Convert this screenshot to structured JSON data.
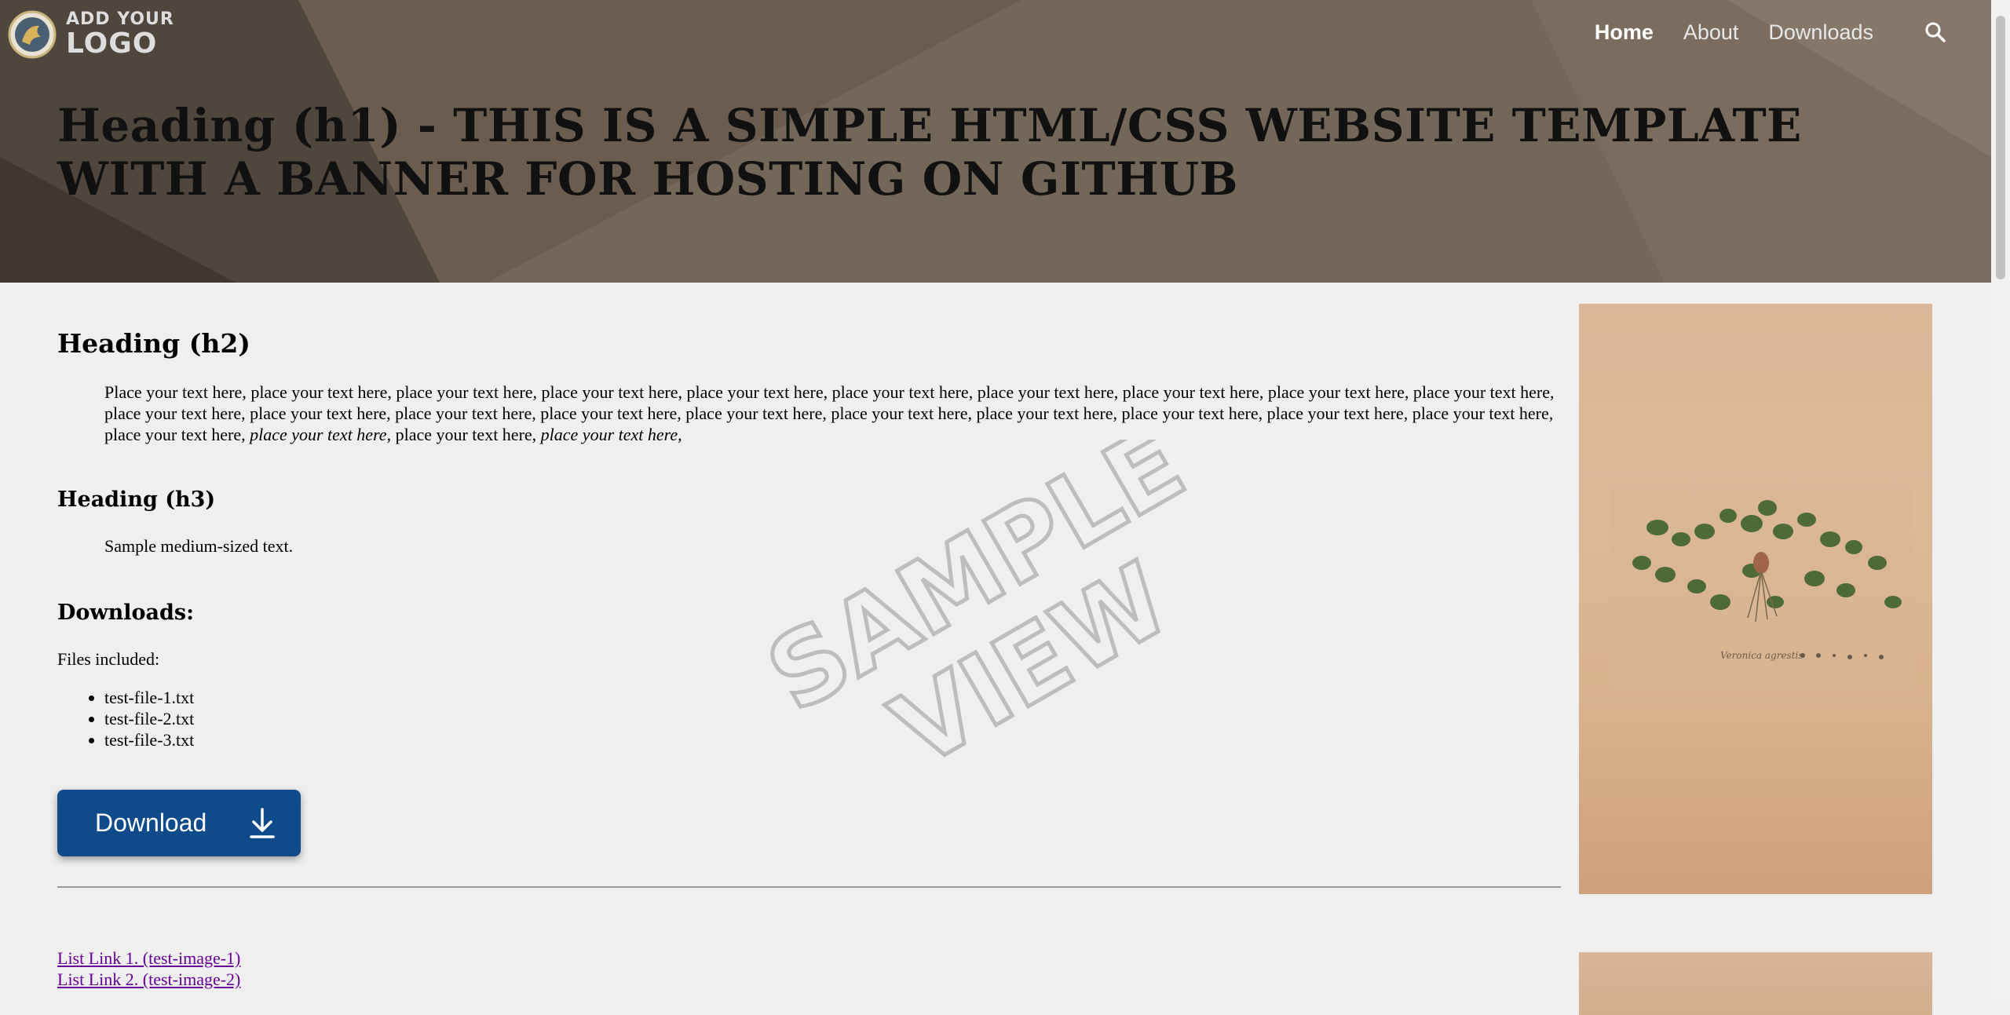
{
  "logo": {
    "line1": "ADD YOUR",
    "line2": "LOGO"
  },
  "nav": {
    "home": "Home",
    "about": "About",
    "downloads": "Downloads"
  },
  "banner": {
    "heading": "Heading (h1) - THIS IS A SIMPLE HTML/CSS WEBSITE TEMPLATE WITH A BANNER FOR HOSTING ON GITHUB"
  },
  "content": {
    "h2": "Heading (h2)",
    "paragraph_plain": "Place your text here, place your text here, place your text here, place your text here, place your text here, place your text here, place your text here, place your text here, place your text here, place your text here, place your text here, place your text here, place your text here, place your text here, place your text here, place your text here, place your text here, place your text here, place your text here, place your text here, place your text here, ",
    "paragraph_italic1": "place your text here,",
    "paragraph_mid": " place your text here, ",
    "paragraph_italic2": "place your text here,",
    "h3": "Heading (h3)",
    "medium_text": "Sample medium-sized text.",
    "downloads_heading": "Downloads:",
    "files_label": "Files included:",
    "files": [
      "test-file-1.txt",
      "test-file-2.txt",
      "test-file-3.txt"
    ],
    "download_button": "Download",
    "links": [
      "List Link 1. (test-image-1)",
      "List Link 2. (test-image-2)"
    ]
  },
  "watermark": {
    "line1": "SAMPLE",
    "line2": "VIEW"
  },
  "colors": {
    "banner": "#5e5247",
    "button": "#0f4a8a",
    "link": "#660099",
    "background": "#efefef"
  },
  "icons": {
    "search": "search-icon",
    "download": "download-arrow-icon",
    "logo": "logo-mark-icon"
  }
}
